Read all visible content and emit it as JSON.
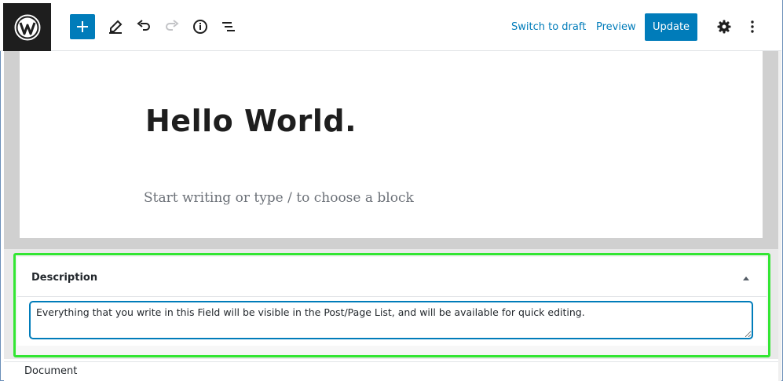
{
  "toolbar": {
    "logo_icon": "wordpress-logo-icon",
    "add_block_icon": "plus-icon",
    "tools_icon": "pencil-icon",
    "undo_icon": "undo-icon",
    "redo_icon": "redo-icon",
    "info_icon": "info-icon",
    "outline_icon": "list-view-icon",
    "switch_to_draft_label": "Switch to draft",
    "preview_label": "Preview",
    "update_label": "Update",
    "settings_icon": "gear-icon",
    "more_icon": "vertical-ellipsis-icon"
  },
  "editor": {
    "post_title": "Hello World.",
    "block_placeholder": "Start writing or type / to choose a block"
  },
  "meta_box": {
    "title": "Description",
    "toggle_icon": "triangle-up-icon",
    "description_value": "Everything that you write in this Field will be visible in the Post/Page List, and will be available for quick editing.",
    "highlight_color": "#33e633"
  },
  "footer": {
    "document_label": "Document"
  },
  "colors": {
    "accent": "#007cba",
    "logo_bg": "#1e1e1e"
  }
}
